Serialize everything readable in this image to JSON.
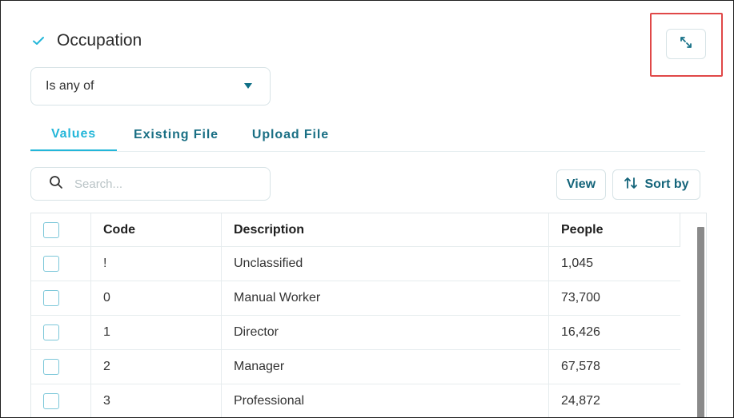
{
  "filter": {
    "title": "Occupation",
    "operator": "Is any of"
  },
  "tabs": [
    {
      "label": "Values",
      "active": true
    },
    {
      "label": "Existing File",
      "active": false
    },
    {
      "label": "Upload File",
      "active": false
    }
  ],
  "search": {
    "placeholder": "Search..."
  },
  "toolbar": {
    "view_label": "View",
    "sort_label": "Sort by"
  },
  "table": {
    "columns": [
      "Code",
      "Description",
      "People"
    ],
    "rows": [
      {
        "code": "!",
        "description": "Unclassified",
        "people": "1,045"
      },
      {
        "code": "0",
        "description": "Manual Worker",
        "people": "73,700"
      },
      {
        "code": "1",
        "description": "Director",
        "people": "16,426"
      },
      {
        "code": "2",
        "description": "Manager",
        "people": "67,578"
      },
      {
        "code": "3",
        "description": "Professional",
        "people": "24,872"
      }
    ]
  },
  "colors": {
    "accent": "#23b6d9",
    "primary": "#14647a",
    "highlight": "#e04848"
  },
  "icons": {
    "header": "check-icon",
    "expand": "expand-icon",
    "search": "search-icon",
    "sort": "sort-icon",
    "dropdown": "caret-down-icon"
  }
}
